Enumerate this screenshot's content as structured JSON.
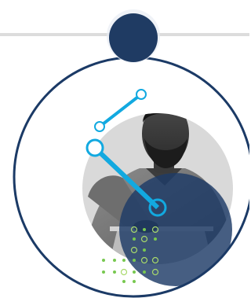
{
  "illustration": {
    "subject": "person-using-laptop",
    "colors": {
      "ring": "#1b3a66",
      "top_node": "#1f3b63",
      "connector_line": "#dcdcdc",
      "cyan_accent": "#12a9e0",
      "gray_disc": "#d9d9d9",
      "navy_overlay": "#1d3a66",
      "dot_green": "#78c850",
      "dot_outline": "#a8d96b",
      "background": "#ffffff"
    },
    "icons": [
      "network-node-icon",
      "dot-grid-pattern"
    ]
  }
}
